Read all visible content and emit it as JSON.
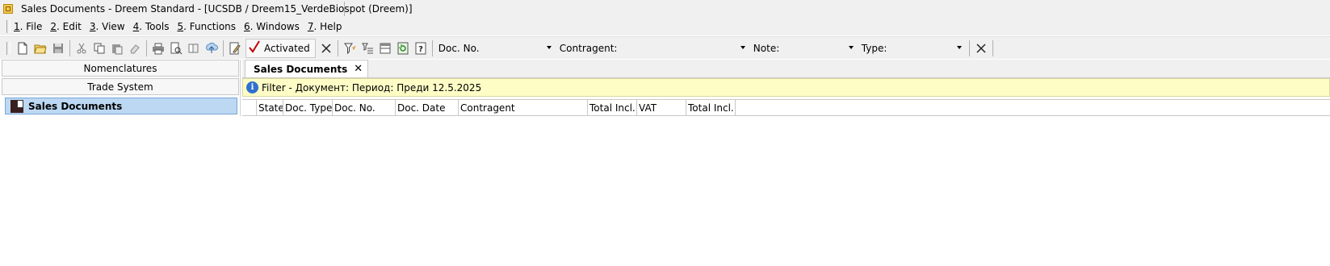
{
  "window": {
    "title": "Sales Documents - Dreem Standard - [UCSDB / Dreem15_VerdeBiospot (Dreem)]"
  },
  "menu": [
    {
      "num": "1",
      "label": ". File"
    },
    {
      "num": "2",
      "label": ". Edit"
    },
    {
      "num": "3",
      "label": ". View"
    },
    {
      "num": "4",
      "label": ". Tools"
    },
    {
      "num": "5",
      "label": ". Functions"
    },
    {
      "num": "6",
      "label": ". Windows"
    },
    {
      "num": "7",
      "label": ". Help"
    }
  ],
  "toolbar": {
    "activated_label": "Activated",
    "filters": [
      {
        "label": "Doc. No."
      },
      {
        "label": "Contragent:"
      },
      {
        "label": "Note:"
      },
      {
        "label": "Type:"
      }
    ]
  },
  "sidebar": {
    "nav": [
      "Nomenclatures",
      "Trade System"
    ],
    "selected": "Sales Documents"
  },
  "tabs": [
    {
      "label": "Sales Documents",
      "close": "✕"
    }
  ],
  "infobar": {
    "text": "Filter - Документ: Период: Преди 12.5.2025"
  },
  "grid": {
    "columns": [
      "State",
      "Doc. Type",
      "Doc. No.",
      "Doc. Date",
      "Contragent",
      "Total Incl....",
      "VAT",
      "Total Incl...."
    ]
  },
  "colors": {
    "selection": "#bcd8f3",
    "infobar": "#fefdc6",
    "info_icon": "#2f6fd0"
  }
}
